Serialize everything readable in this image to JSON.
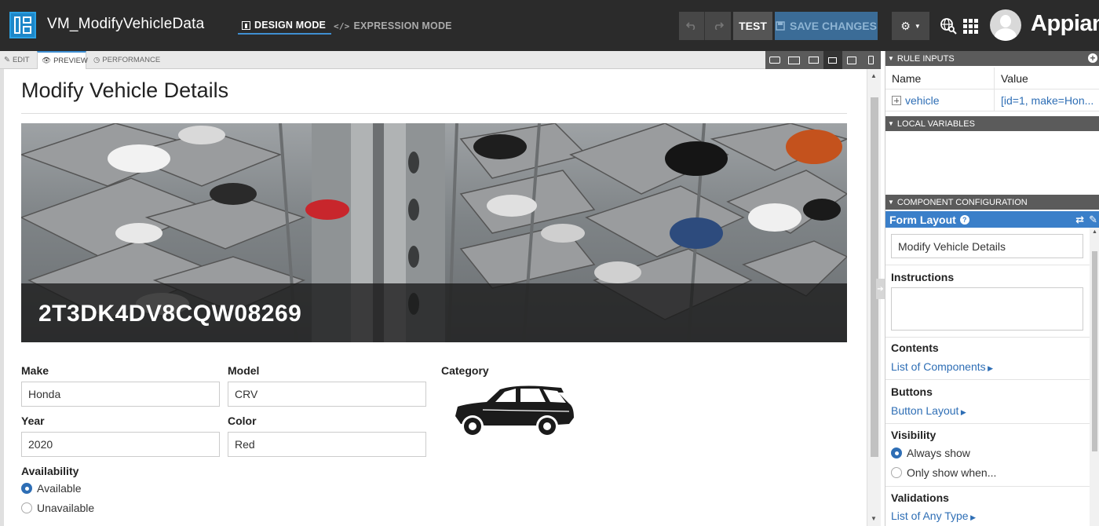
{
  "header": {
    "app_title": "VM_ModifyVehicleData",
    "design_mode": "DESIGN MODE",
    "expression_mode": "EXPRESSION MODE",
    "undo_icon": "undo-icon",
    "redo_icon": "redo-icon",
    "test_label": "TEST",
    "save_label": "SAVE CHANGES",
    "brand": "Appian"
  },
  "subtabs": {
    "edit": "EDIT",
    "preview": "PREVIEW",
    "performance": "PERFORMANCE"
  },
  "form": {
    "title": "Modify Vehicle Details",
    "banner_text": "2T3DK4DV8CQW08269",
    "make_label": "Make",
    "make_value": "Honda",
    "model_label": "Model",
    "model_value": "CRV",
    "category_label": "Category",
    "year_label": "Year",
    "year_value": "2020",
    "color_label": "Color",
    "color_value": "Red",
    "availability_label": "Availability",
    "availability_options": [
      "Available",
      "Unavailable"
    ],
    "availability_selected": "Available"
  },
  "rule_inputs": {
    "heading": "RULE INPUTS",
    "columns": [
      "Name",
      "Value"
    ],
    "rows": [
      {
        "name": "vehicle",
        "value": "[id=1, make=Hon..."
      }
    ]
  },
  "local_variables": {
    "heading": "LOCAL VARIABLES"
  },
  "component_configuration": {
    "heading": "COMPONENT CONFIGURATION",
    "component_name": "Form Layout",
    "label_value": "Modify Vehicle Details",
    "instructions_label": "Instructions",
    "instructions_value": "",
    "contents_label": "Contents",
    "contents_link": "List of Components",
    "buttons_label": "Buttons",
    "buttons_link": "Button Layout",
    "visibility_label": "Visibility",
    "visibility_options": [
      "Always show",
      "Only show when..."
    ],
    "visibility_selected": "Always show",
    "validations_label": "Validations",
    "validations_link": "List of Any Type"
  },
  "colors": {
    "accent": "#3a7fc9",
    "link": "#2e6eb5",
    "topbar": "#2b2b2b",
    "save_button": "#3b6c97"
  }
}
